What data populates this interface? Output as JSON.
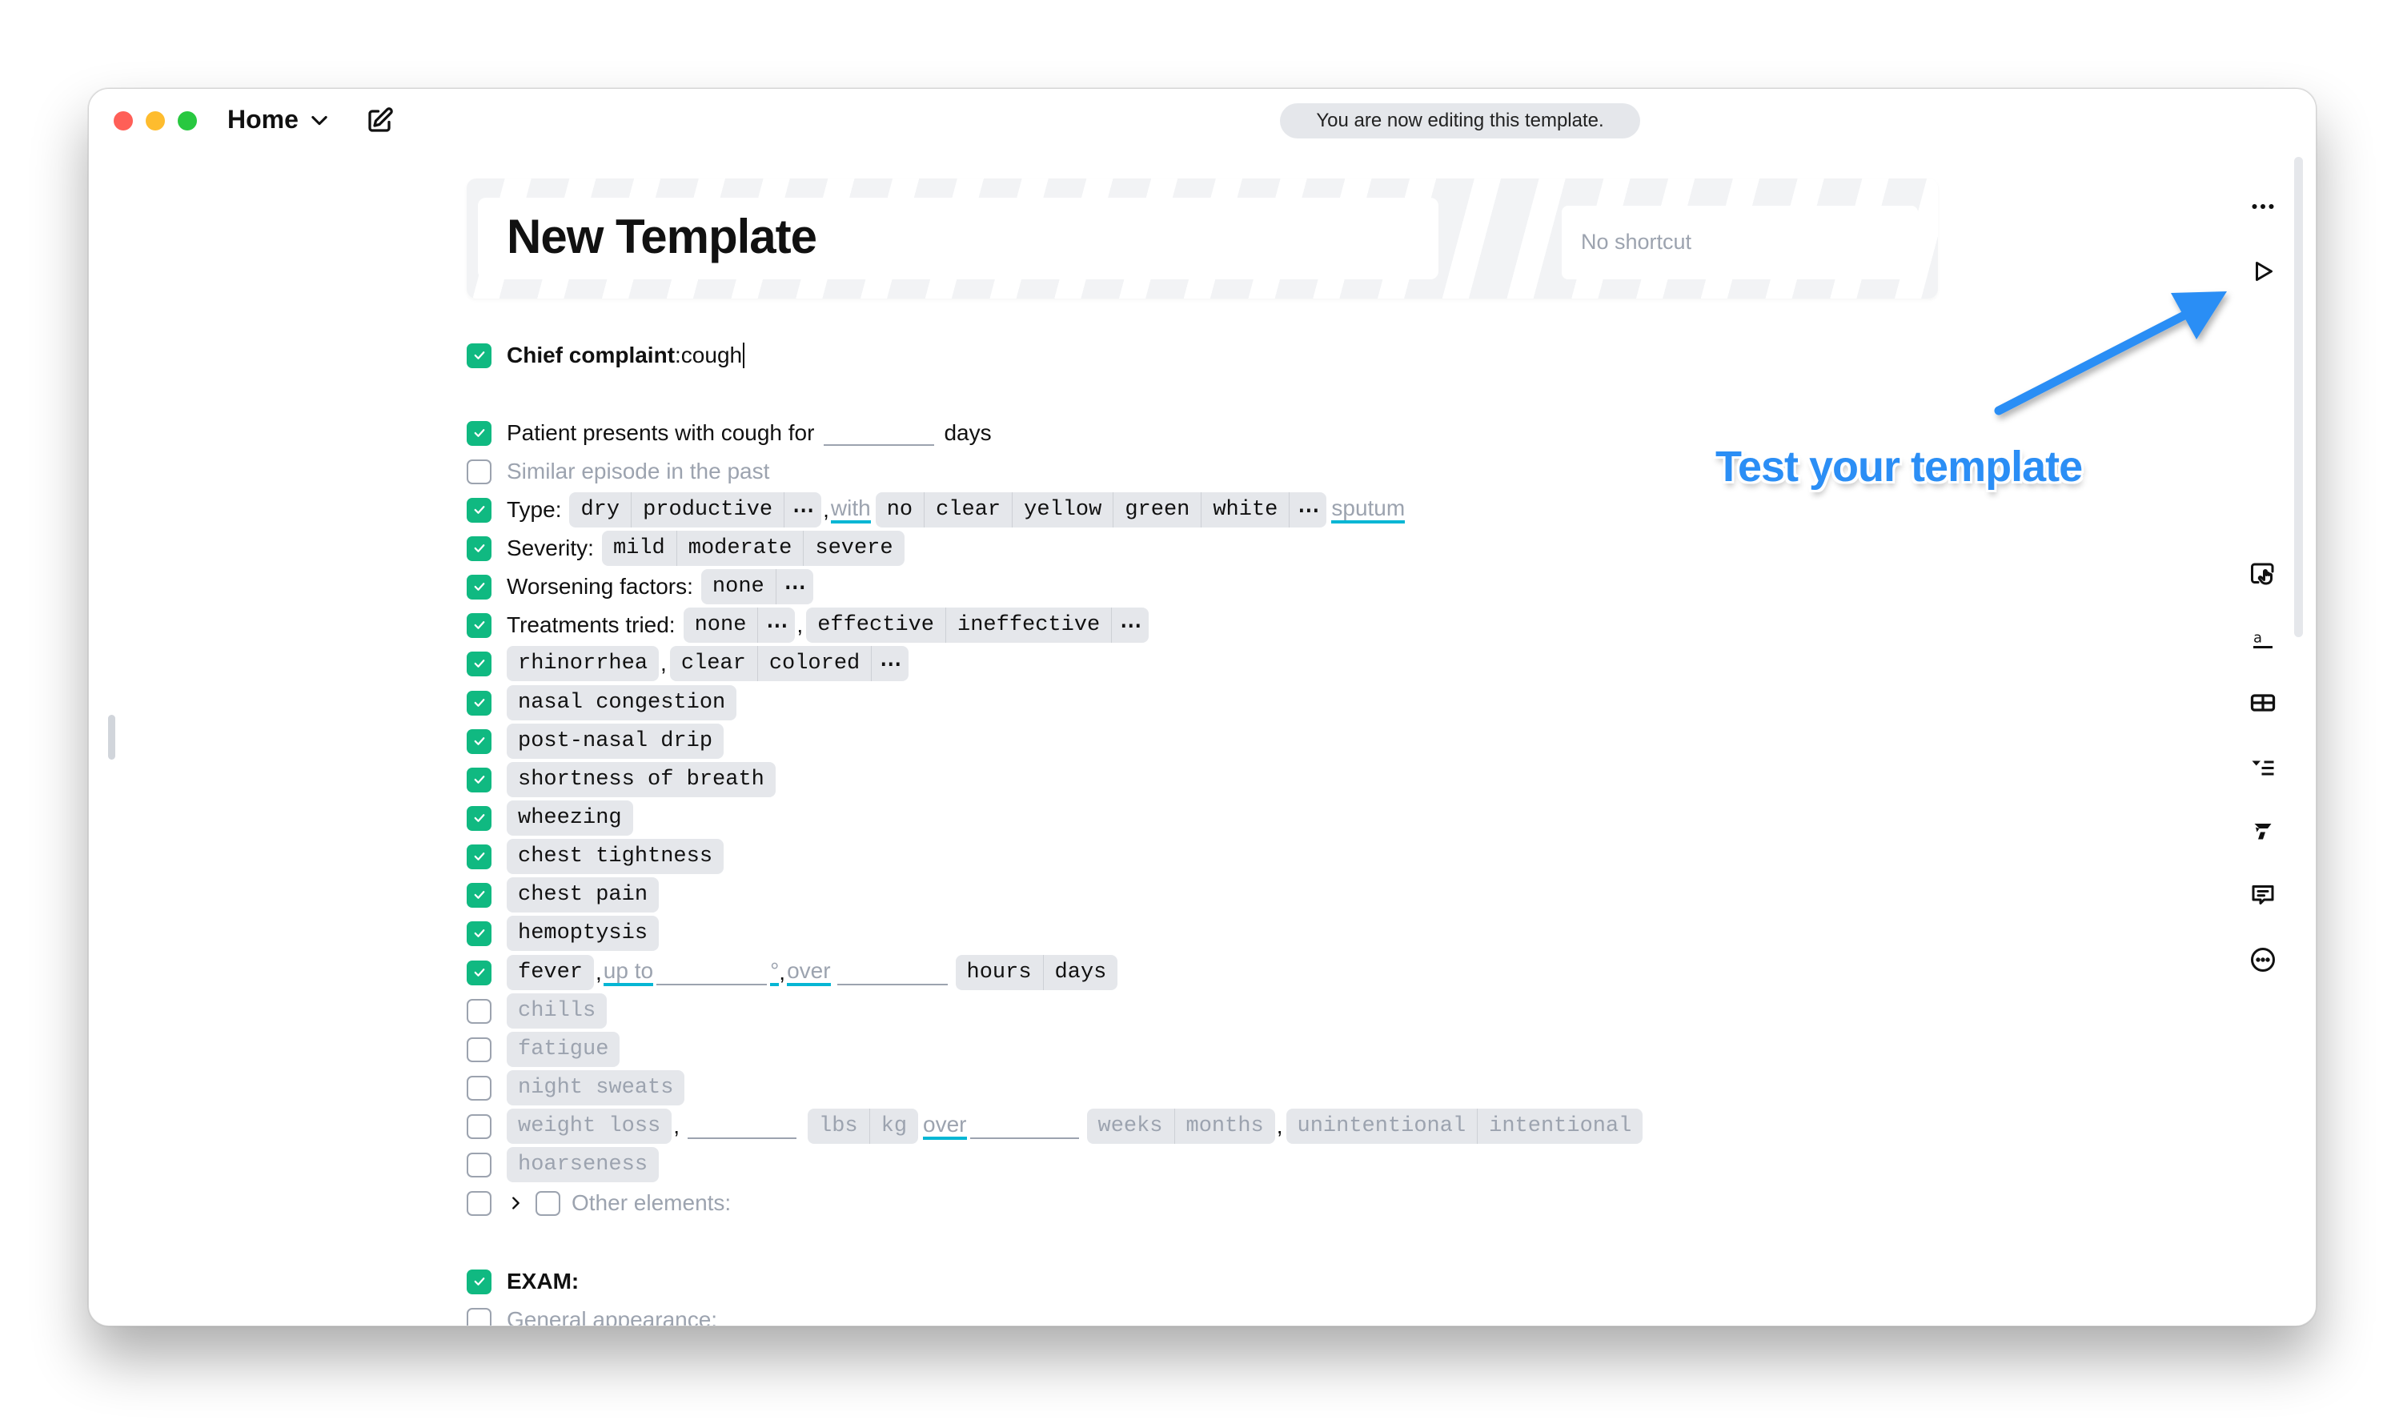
{
  "titlebar": {
    "home_label": "Home",
    "toast": "You are now editing this template."
  },
  "template": {
    "title": "New Template",
    "shortcut_placeholder": "No shortcut"
  },
  "annotation": {
    "text": "Test your template",
    "color": "#2b8ef5"
  },
  "colors": {
    "checkbox_on": "#10b981",
    "link_underline": "#06b6d4",
    "pill_bg": "#e5e7eb"
  },
  "checklist": {
    "chief": {
      "label": "Chief complaint",
      "sep": ": ",
      "value": "cough",
      "checked": true
    },
    "patient": {
      "pre": "Patient presents with cough for",
      "post": "days",
      "checked": true
    },
    "similar": {
      "label": "Similar episode in the past",
      "checked": false
    },
    "type": {
      "label": "Type:",
      "opts1": [
        "dry",
        "productive"
      ],
      "comma": ",",
      "with": "with",
      "opts2": [
        "no",
        "clear",
        "yellow",
        "green",
        "white"
      ],
      "sputum": "sputum",
      "more": "⋯",
      "checked": true
    },
    "severity": {
      "label": "Severity:",
      "opts": [
        "mild",
        "moderate",
        "severe"
      ],
      "checked": true
    },
    "worsening": {
      "label": "Worsening factors:",
      "opts": [
        "none"
      ],
      "more": "⋯",
      "checked": true
    },
    "treatments": {
      "label": "Treatments tried:",
      "opts1": [
        "none"
      ],
      "comma": ",",
      "opts2": [
        "effective",
        "ineffective"
      ],
      "more": "⋯",
      "checked": true
    },
    "rhinorrhea": {
      "label": "rhinorrhea",
      "comma": ",",
      "opts": [
        "clear",
        "colored"
      ],
      "more": "⋯",
      "checked": true
    },
    "simple_items": [
      {
        "label": "nasal congestion",
        "checked": true
      },
      {
        "label": "post-nasal drip",
        "checked": true
      },
      {
        "label": "shortness of breath",
        "checked": true
      },
      {
        "label": "wheezing",
        "checked": true
      },
      {
        "label": "chest tightness",
        "checked": true
      },
      {
        "label": "chest pain",
        "checked": true
      },
      {
        "label": "hemoptysis",
        "checked": true
      }
    ],
    "fever": {
      "label": "fever",
      "comma": ",",
      "upto": "up to",
      "degree": "°",
      "over": "over",
      "units": [
        "hours",
        "days"
      ],
      "checked": true
    },
    "unchecked_items": [
      {
        "label": "chills",
        "checked": false
      },
      {
        "label": "fatigue",
        "checked": false
      },
      {
        "label": "night sweats",
        "checked": false
      }
    ],
    "weight": {
      "label": "weight loss",
      "comma": ",",
      "units": [
        "lbs",
        "kg"
      ],
      "over": "over",
      "periods": [
        "weeks",
        "months"
      ],
      "intent": [
        "unintentional",
        "intentional"
      ],
      "checked": false
    },
    "hoarseness": {
      "label": "hoarseness",
      "checked": false
    },
    "other": {
      "label": "Other elements:",
      "checked": false
    },
    "exam": {
      "label": "EXAM:",
      "checked": true
    },
    "general": {
      "label": "General appearance:",
      "checked": false
    }
  },
  "right_toolbar": [
    {
      "icon": "more-horizontal-icon"
    },
    {
      "icon": "play-icon"
    },
    {
      "icon": "hand-pointer-icon"
    },
    {
      "icon": "text-field-icon"
    },
    {
      "icon": "table-icon"
    },
    {
      "icon": "dropdown-list-icon"
    },
    {
      "icon": "branch-icon"
    },
    {
      "icon": "comment-icon"
    },
    {
      "icon": "more-circle-icon"
    }
  ]
}
